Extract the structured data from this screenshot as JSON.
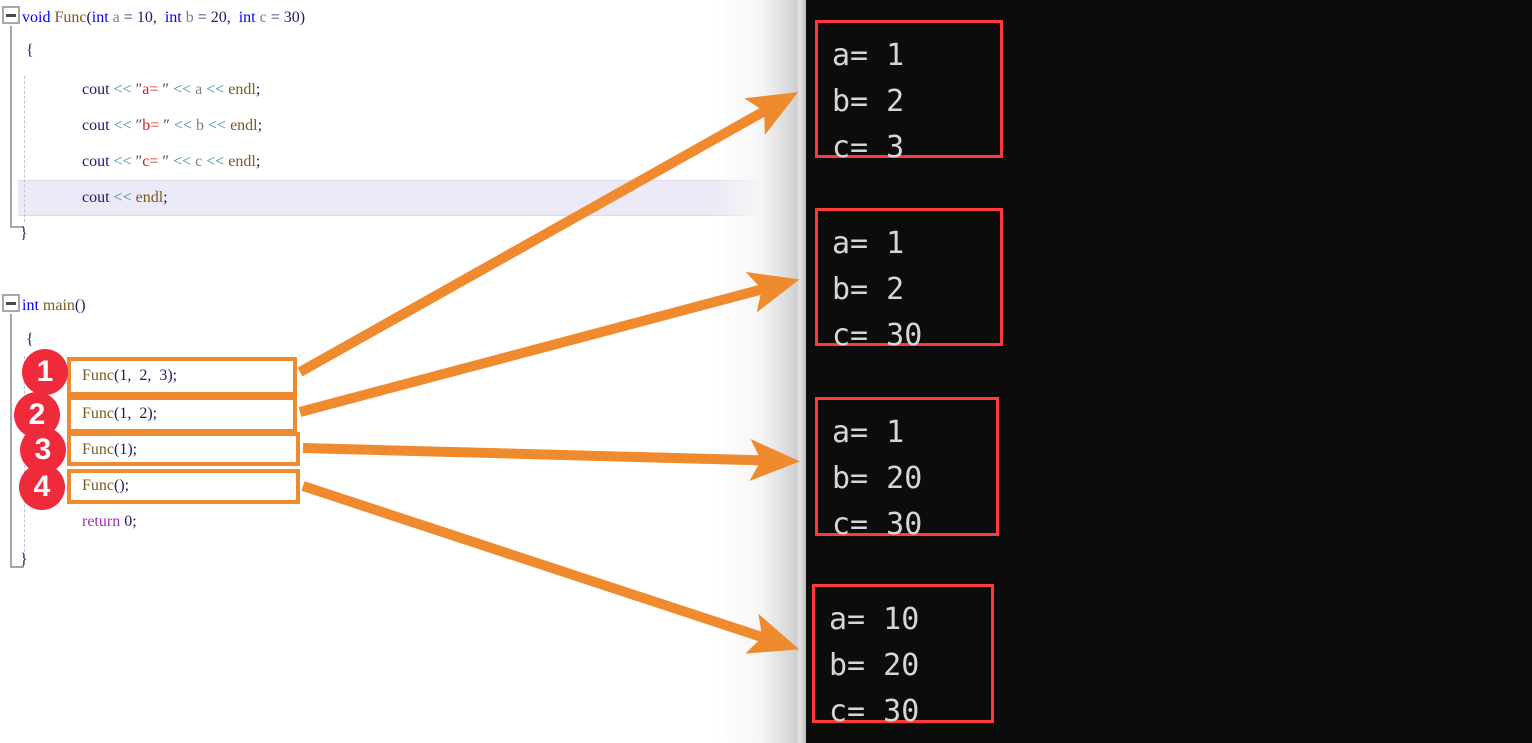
{
  "editor": {
    "language": "cpp",
    "lines": [
      {
        "id": "func-signature",
        "text": "void Func(int a = 10,  int b = 20,  int c = 30)"
      },
      {
        "id": "func-open-brace",
        "text": "{"
      },
      {
        "id": "cout-a",
        "text": "cout << \"a= \" << a << endl;"
      },
      {
        "id": "cout-b",
        "text": "cout << \"b= \" << b << endl;"
      },
      {
        "id": "cout-c",
        "text": "cout << \"c= \" << c << endl;"
      },
      {
        "id": "cout-endl",
        "text": "cout << endl;"
      },
      {
        "id": "func-close-brace",
        "text": "}"
      },
      {
        "id": "main-signature",
        "text": "int main()"
      },
      {
        "id": "main-open-brace",
        "text": "{"
      },
      {
        "id": "call-1",
        "text": "Func(1,  2,  3);"
      },
      {
        "id": "call-2",
        "text": "Func(1,  2);"
      },
      {
        "id": "call-3",
        "text": "Func(1);"
      },
      {
        "id": "call-4",
        "text": "Func();"
      },
      {
        "id": "return-stmt",
        "text": "return 0;"
      },
      {
        "id": "main-close-brace",
        "text": "}"
      }
    ],
    "tokens": {
      "kw_void": "void",
      "kw_int": "int",
      "fn_func": "Func",
      "fn_main": "main",
      "kw_return": "return",
      "id_cout": "cout",
      "id_endl": "endl",
      "shift_op": "<<",
      "default_a": "10",
      "default_b": "20",
      "default_c": "30",
      "str_a": "a= ",
      "str_b": "b= ",
      "str_c": "c= ",
      "var_a": "a",
      "var_b": "b",
      "var_c": "c",
      "ret_value": "0",
      "quote": "\"",
      "semicolon": ";",
      "comma": ",",
      "equals": "=",
      "paren_open": "(",
      "paren_close": ")",
      "brace_open": "{",
      "brace_close": "}"
    }
  },
  "callouts": [
    {
      "number": "1",
      "call": "Func(1,  2,  3);"
    },
    {
      "number": "2",
      "call": "Func(1,  2);"
    },
    {
      "number": "3",
      "call": "Func(1);"
    },
    {
      "number": "4",
      "call": "Func();"
    }
  ],
  "console": {
    "outputs": [
      {
        "id": "output-1",
        "lines": [
          "a= 1",
          "b= 2",
          "c= 3"
        ]
      },
      {
        "id": "output-2",
        "lines": [
          "a= 1",
          "b= 2",
          "c= 30"
        ]
      },
      {
        "id": "output-3",
        "lines": [
          "a= 1",
          "b= 20",
          "c= 30"
        ]
      },
      {
        "id": "output-4",
        "lines": [
          "a= 10",
          "b= 20",
          "c= 30"
        ]
      }
    ]
  },
  "colors": {
    "keyword": "#0000ff",
    "function": "#7a5a20",
    "string": "#cc2222",
    "identifier": "#808080",
    "return_keyword": "#9b30c0",
    "shift_operator": "#2e8b9a",
    "callout_border": "#f08a2e",
    "badge_fill": "#ef2b3b",
    "console_background": "#0c0c0c",
    "console_text": "#d6d6d6",
    "output_border": "#ff3b39",
    "arrow": "#f08a2e"
  }
}
